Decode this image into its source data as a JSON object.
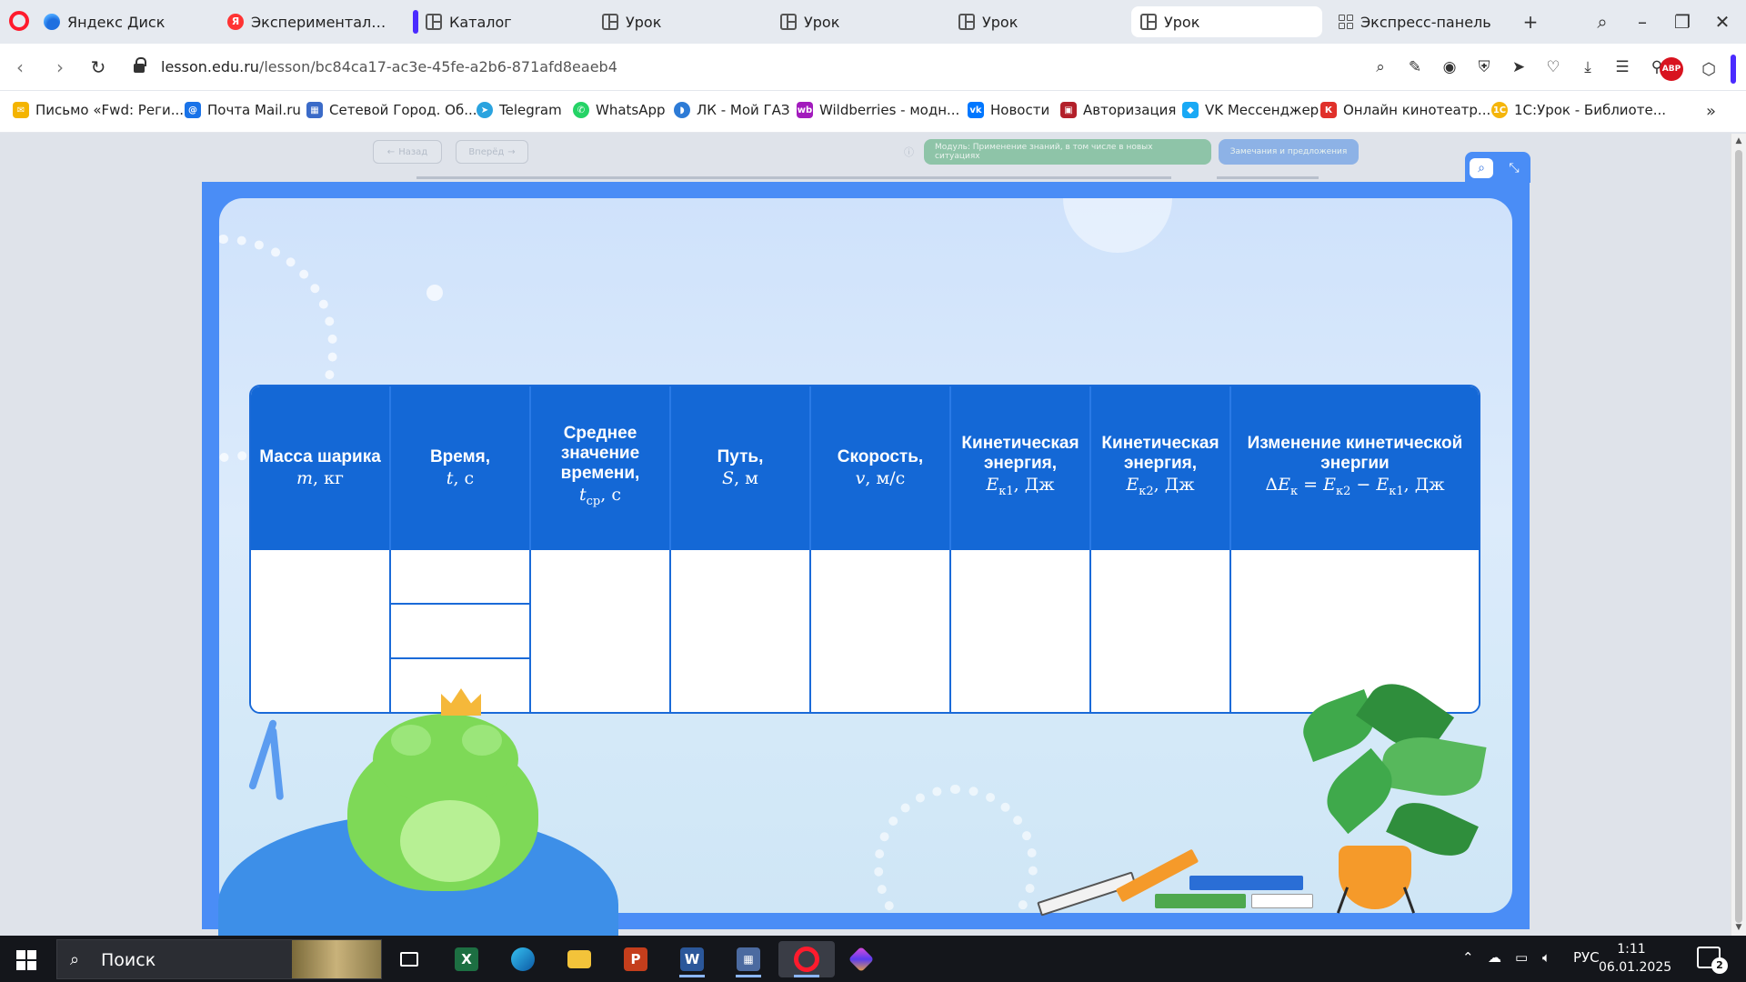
{
  "browser": {
    "tabs": [
      {
        "label": "Яндекс Диск",
        "icon": "yandex-disk-icon"
      },
      {
        "label": "Экспериментальное оп",
        "icon": "yandex-icon"
      },
      {
        "label": "Каталог",
        "icon": "grid-icon"
      },
      {
        "label": "Урок",
        "icon": "grid-icon"
      },
      {
        "label": "Урок",
        "icon": "grid-icon"
      },
      {
        "label": "Урок",
        "icon": "grid-icon"
      },
      {
        "label": "Урок",
        "icon": "grid-icon",
        "active": true
      }
    ],
    "express_panel": "Экспресс-панель",
    "url_domain": "lesson.edu.ru",
    "url_path": "/lesson/bc84ca17-ac3e-45fe-a2b6-871afd8eaeb4",
    "adblock_label": "ABP"
  },
  "bookmarks": [
    {
      "label": "Письмо «Fwd: Реги...",
      "color": "#f4b400"
    },
    {
      "label": "Почта Mail.ru",
      "color": "#1a73e8"
    },
    {
      "label": "Сетевой Город. Об...",
      "color": "#3b6bc8"
    },
    {
      "label": "Telegram",
      "color": "#2aa3df"
    },
    {
      "label": "WhatsApp",
      "color": "#25d366"
    },
    {
      "label": "ЛК - Мой ГАЗ",
      "color": "#2d7bd6"
    },
    {
      "label": "Wildberries - модн...",
      "color": "#a21bbd"
    },
    {
      "label": "Новости",
      "color": "#0077ff"
    },
    {
      "label": "Авторизация",
      "color": "#b3202a"
    },
    {
      "label": "VK Мессенджер",
      "color": "#19a9f5"
    },
    {
      "label": "Онлайн кинотеатр...",
      "color": "#e0312b"
    },
    {
      "label": "1С:Урок - Библиоте...",
      "color": "#f5b50a"
    }
  ],
  "lesson": {
    "back_label": "Назад",
    "forward_label": "Вперёд",
    "module_label": "Модуль: Применение знаний, в том числе в новых ситуациях",
    "feedback_label": "Замечания и предложения"
  },
  "table": {
    "headers": [
      {
        "text": "Масса шарика",
        "math": "m, кг"
      },
      {
        "text": "Время,",
        "math": "t, с"
      },
      {
        "text": "Среднее значение времени,",
        "math": "tср, с"
      },
      {
        "text": "Путь,",
        "math": "S, м"
      },
      {
        "text": "Скорость,",
        "math": "v, м/с"
      },
      {
        "text": "Кинетическая энергия,",
        "math": "Eк1, Дж"
      },
      {
        "text": "Кинетическая энергия,",
        "math": "Eк2, Дж"
      },
      {
        "text": "Изменение кинетической энергии",
        "math": "ΔEк = Eк2 − Eк1, Дж"
      }
    ],
    "time_subrows": 3
  },
  "taskbar": {
    "search_placeholder": "Поиск",
    "language": "РУС",
    "time": "1:11",
    "date": "06.01.2025",
    "notification_count": "2",
    "apps": [
      "task-view",
      "excel",
      "edge",
      "file-explorer",
      "powerpoint",
      "word",
      "calculator",
      "opera",
      "gem-app"
    ]
  }
}
